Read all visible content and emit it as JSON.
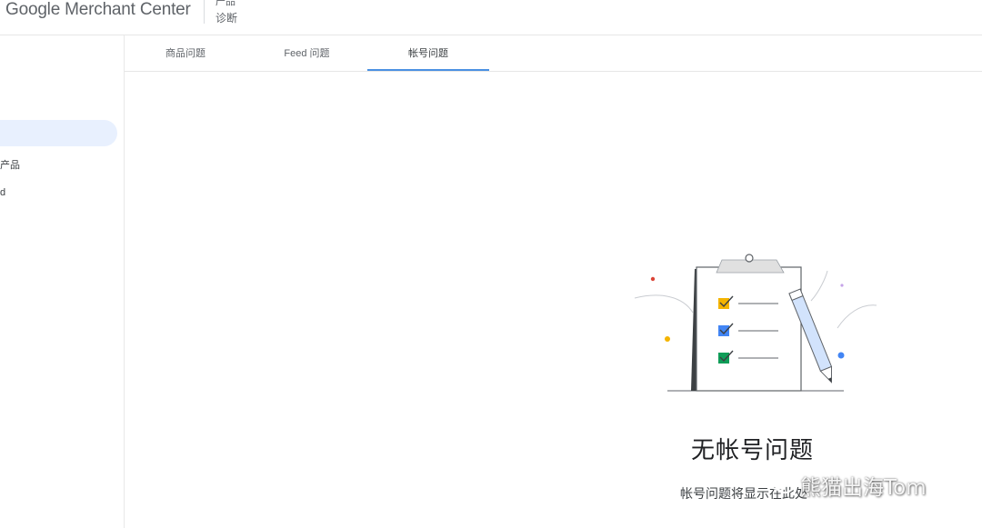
{
  "header": {
    "app_title": "Google Merchant Center",
    "breadcrumb_parent": "产品",
    "breadcrumb_current": "诊断"
  },
  "sidebar": {
    "items": [
      {
        "label": "产品"
      },
      {
        "label": "d"
      }
    ]
  },
  "tabs": [
    {
      "label": "商品问题",
      "active": false
    },
    {
      "label": "Feed 问题",
      "active": false
    },
    {
      "label": "帐号问题",
      "active": true
    }
  ],
  "empty_state": {
    "title": "无帐号问题",
    "subtitle": "帐号问题将显示在此处"
  },
  "watermark": {
    "text": "熊猫出海Tom"
  },
  "colors": {
    "accent": "#4a90e2",
    "active_bg": "#e8f0fe",
    "check_yellow": "#f4b400",
    "check_blue": "#4285f4",
    "check_green": "#0f9d58"
  }
}
